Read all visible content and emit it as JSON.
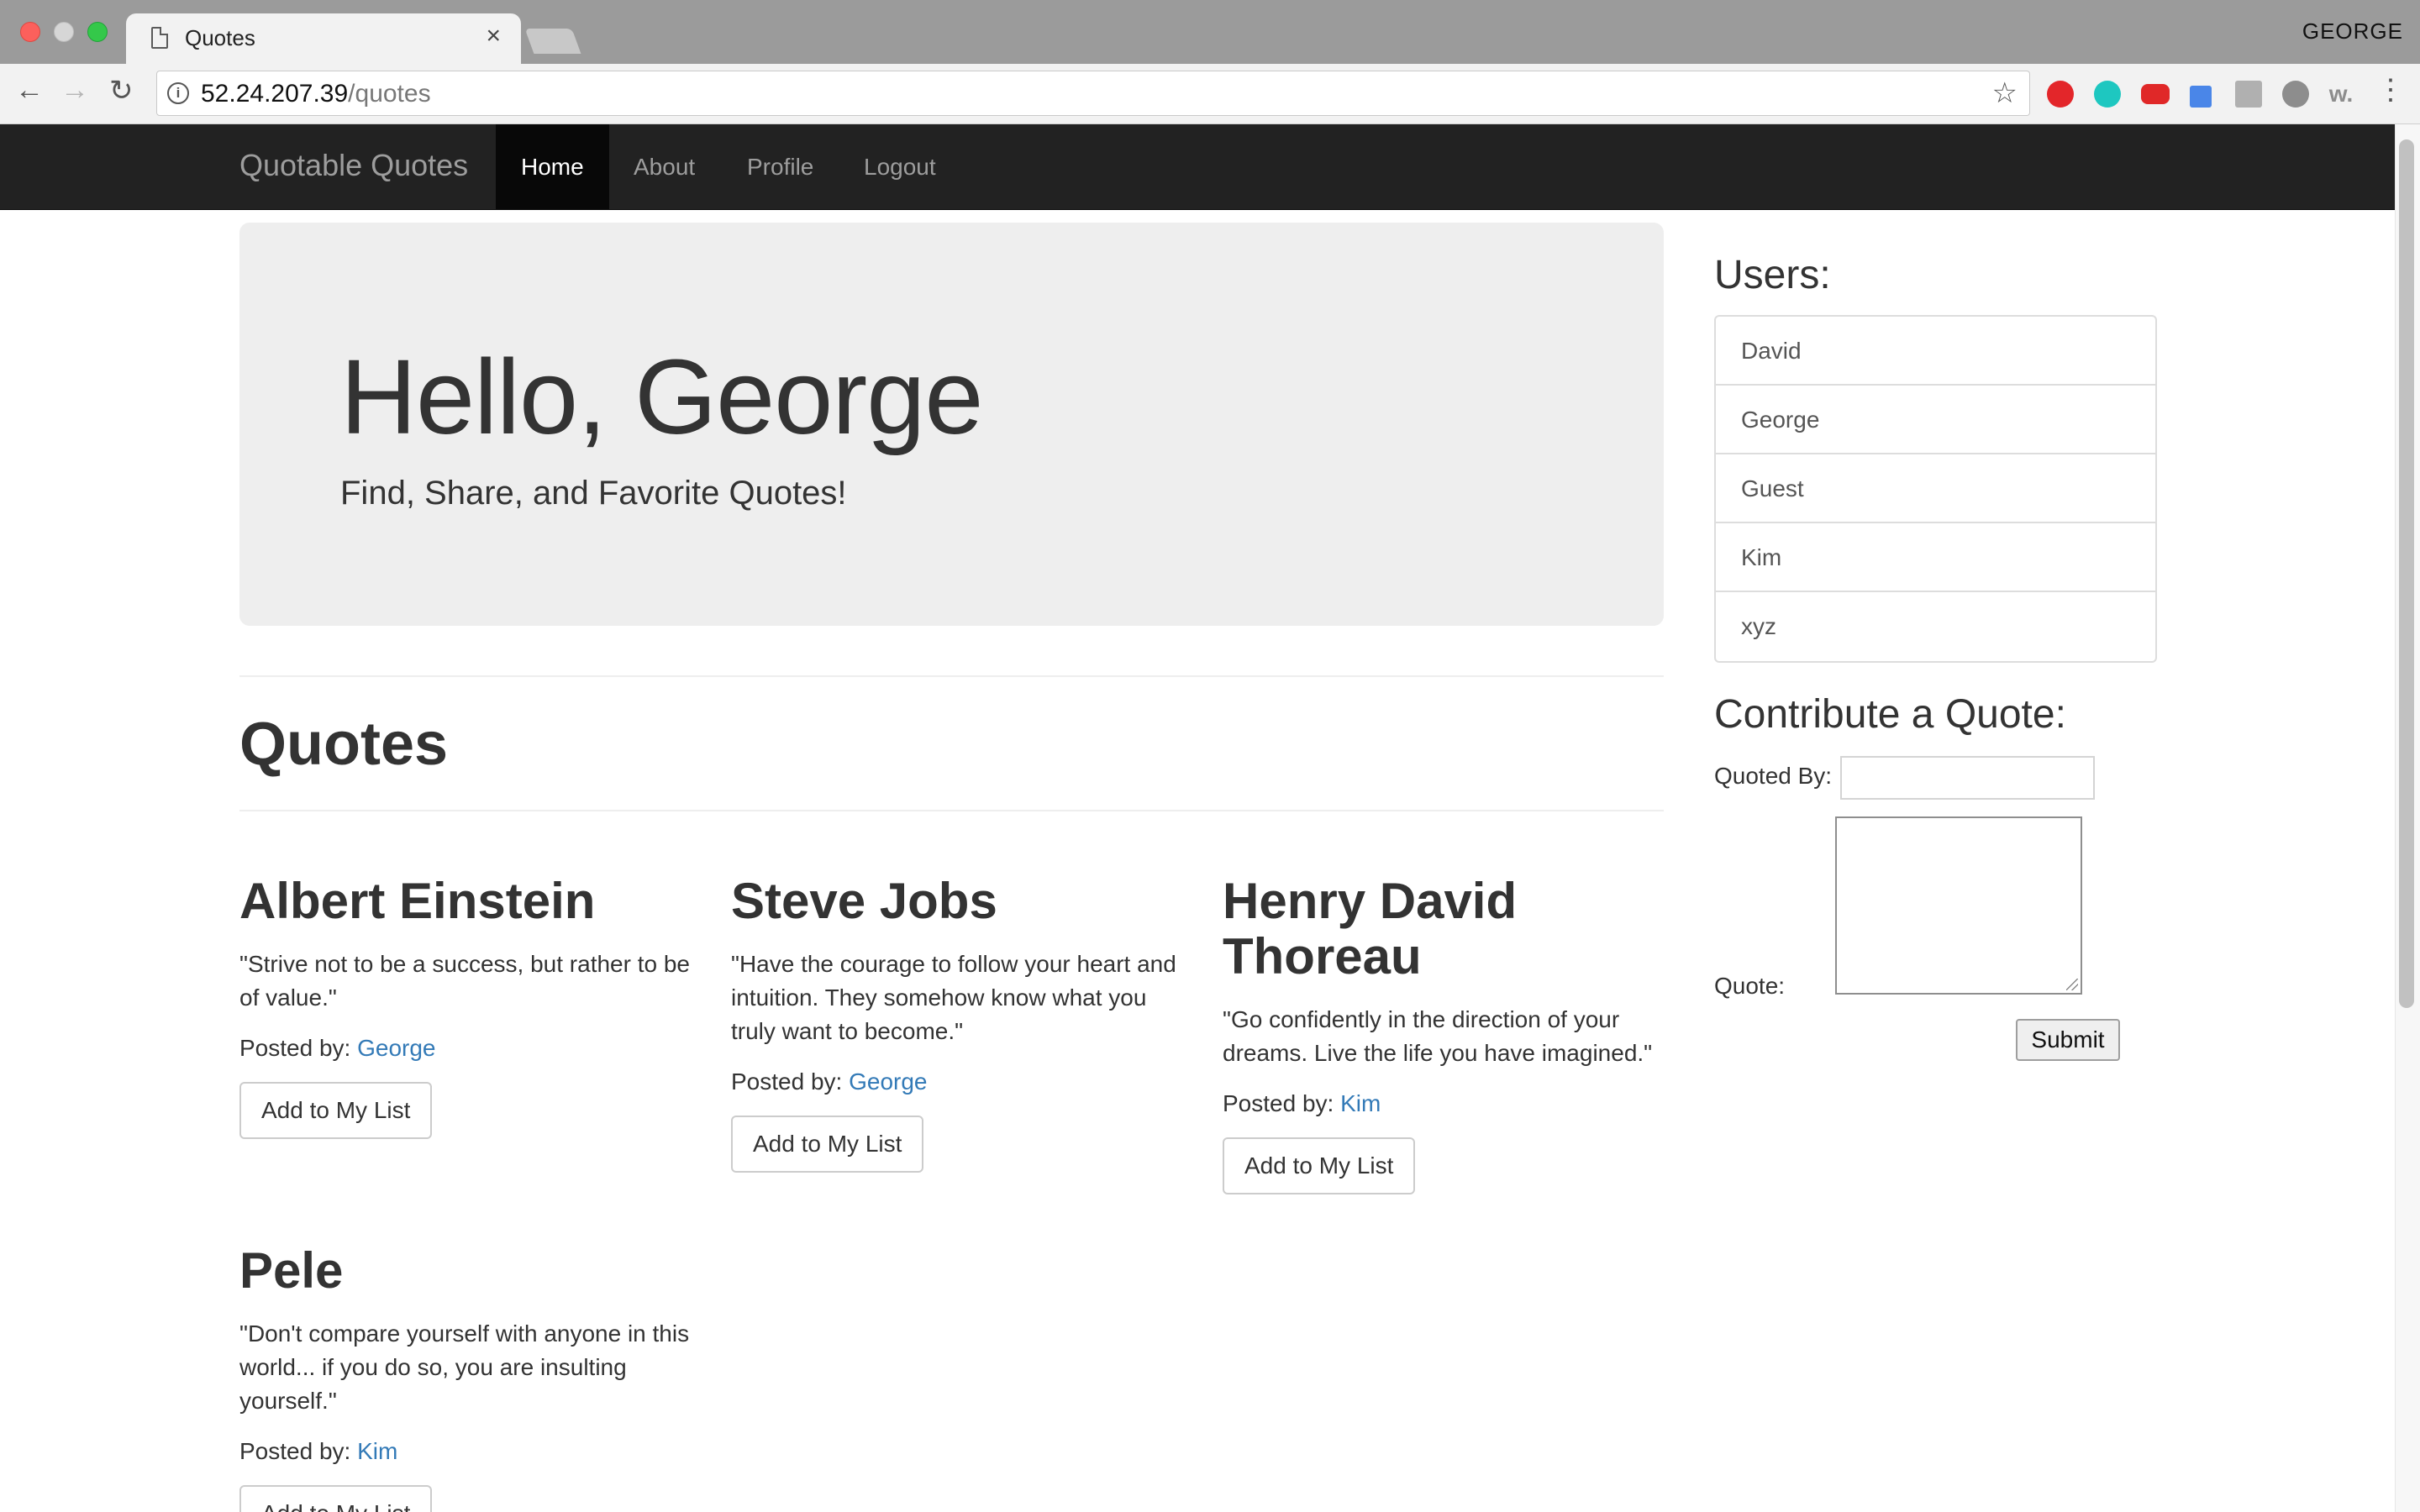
{
  "browser": {
    "tab_title": "Quotes",
    "tab_close": "×",
    "profile_name": "GEORGE",
    "url_host": "52.24.207.39",
    "url_path": "/quotes",
    "back_glyph": "←",
    "forward_glyph": "→",
    "reload_glyph": "↻",
    "star_glyph": "☆",
    "menu_glyph": "⋮",
    "info_glyph": "i",
    "extension_icons": [
      "opera-icon",
      "mightytext-icon",
      "youtube-icon",
      "eyedropper-icon",
      "pdf-icon",
      "translate-icon",
      "wikiwand-icon"
    ]
  },
  "navbar": {
    "brand": "Quotable Quotes",
    "links": [
      {
        "label": "Home",
        "active": true
      },
      {
        "label": "About",
        "active": false
      },
      {
        "label": "Profile",
        "active": false
      },
      {
        "label": "Logout",
        "active": false
      }
    ]
  },
  "jumbotron": {
    "title": "Hello, George",
    "subtitle": "Find, Share, and Favorite Quotes!"
  },
  "quotes_section": {
    "title": "Quotes",
    "add_button_label": "Add to My List",
    "posted_by_label": "Posted by:",
    "items": [
      {
        "author": "Albert Einstein",
        "text": "\"Strive not to be a success, but rather to be of value.\"",
        "posted_by": "George"
      },
      {
        "author": "Steve Jobs",
        "text": "\"Have the courage to follow your heart and intuition. They somehow know what you truly want to become.\"",
        "posted_by": "George"
      },
      {
        "author": "Henry David Thoreau",
        "text": "\"Go confidently in the direction of your dreams. Live the life you have imagined.\"",
        "posted_by": "Kim"
      },
      {
        "author": "Pele",
        "text": "\"Don't compare yourself with anyone in this world... if you do so, you are insulting yourself.\"",
        "posted_by": "Kim"
      }
    ]
  },
  "sidebar": {
    "users_heading": "Users:",
    "users": [
      "David",
      "George",
      "Guest",
      "Kim",
      "xyz"
    ],
    "contribute_heading": "Contribute a Quote:",
    "quoted_by_label": "Quoted By:",
    "quoted_by_value": "",
    "quote_label": "Quote:",
    "quote_value": "",
    "submit_label": "Submit"
  },
  "colors": {
    "navbar_bg": "#222222",
    "navbar_active_bg": "#080808",
    "link": "#337ab7",
    "jumbotron_bg": "#eeeeee"
  }
}
